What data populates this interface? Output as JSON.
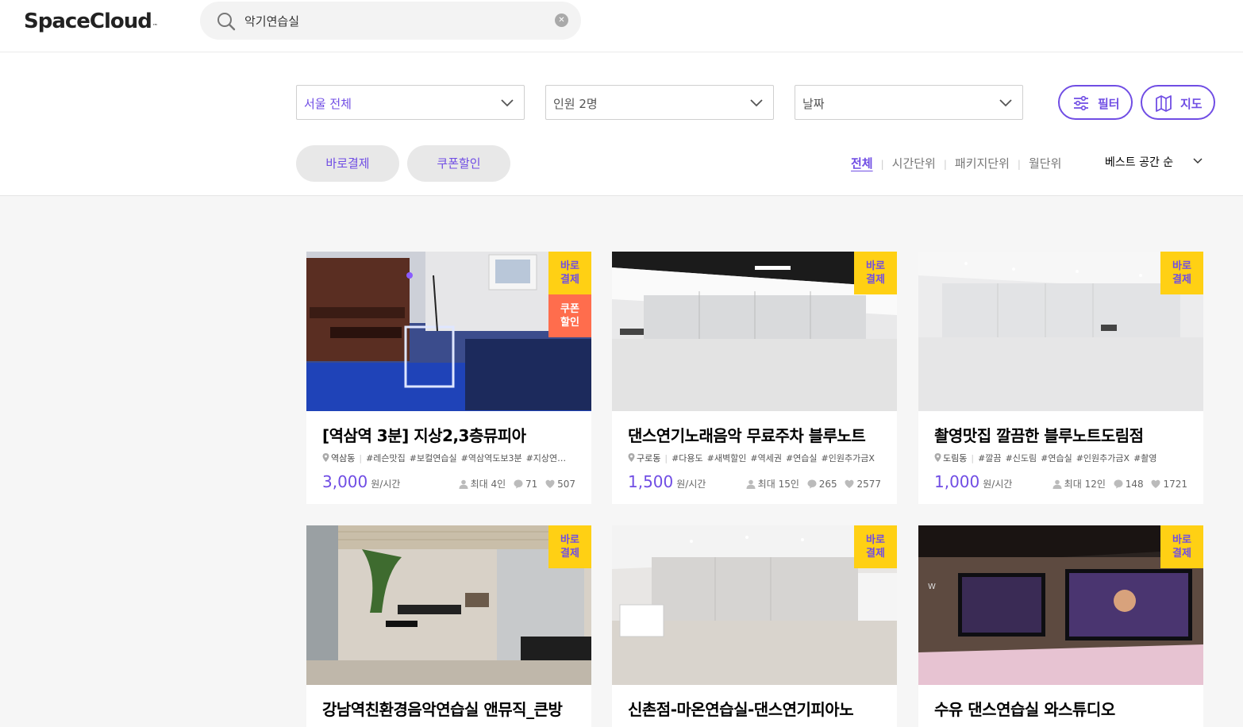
{
  "header": {
    "logo": "SpaceCloud",
    "logo_mark": "™",
    "search": {
      "value": "악기연습실",
      "placeholder": ""
    },
    "icons": {
      "search": "search-icon",
      "clear": "clear-icon"
    }
  },
  "filters": {
    "region": "서울 전체",
    "people": "인원 2명",
    "date": "날짜",
    "filter_button": "필터",
    "map_button": "지도",
    "chips": [
      "바로결제",
      "쿠폰할인"
    ],
    "tabs": [
      "전체",
      "시간단위",
      "패키지단위",
      "월단위"
    ],
    "active_tab": "전체",
    "sort": "베스트 공간 순"
  },
  "colors": {
    "accent": "#704de4",
    "badge_pay": "#ffd014",
    "badge_coupon": "#ff6d4d"
  },
  "cards": [
    {
      "title": "[역삼역 3분] 지상2,3층뮤피아",
      "location": "역삼동",
      "tags": [
        "#레슨맛집",
        "#보컬연습실",
        "#역삼역도보3분",
        "#지상연…"
      ],
      "price": "3,000",
      "unit": "원/시간",
      "capacity": "최대 4인",
      "reviews": "71",
      "likes": "507",
      "badge_pay": "바로\n결제",
      "badge_coupon": "쿠폰\n할인"
    },
    {
      "title": "댄스연기노래음악 무료주차 블루노트",
      "location": "구로동",
      "tags": [
        "#다용도",
        "#새벽할인",
        "#역세권",
        "#연습실",
        "#인원추가금X"
      ],
      "price": "1,500",
      "unit": "원/시간",
      "capacity": "최대 15인",
      "reviews": "265",
      "likes": "2577",
      "badge_pay": "바로\n결제"
    },
    {
      "title": "촬영맛집 깔끔한 블루노트도림점",
      "location": "도림동",
      "tags": [
        "#깔끔",
        "#신도림",
        "#연습실",
        "#인원추가금X",
        "#촬영"
      ],
      "price": "1,000",
      "unit": "원/시간",
      "capacity": "최대 12인",
      "reviews": "148",
      "likes": "1721",
      "badge_pay": "바로\n결제"
    },
    {
      "title": "강남역친환경음악연습실 앤뮤직_큰방",
      "badge_pay": "바로\n결제"
    },
    {
      "title": "신촌점-마온연습실-댄스연기피아노",
      "badge_pay": "바로\n결제"
    },
    {
      "title": "수유 댄스연습실 와스튜디오",
      "badge_pay": "바로\n결제"
    }
  ]
}
